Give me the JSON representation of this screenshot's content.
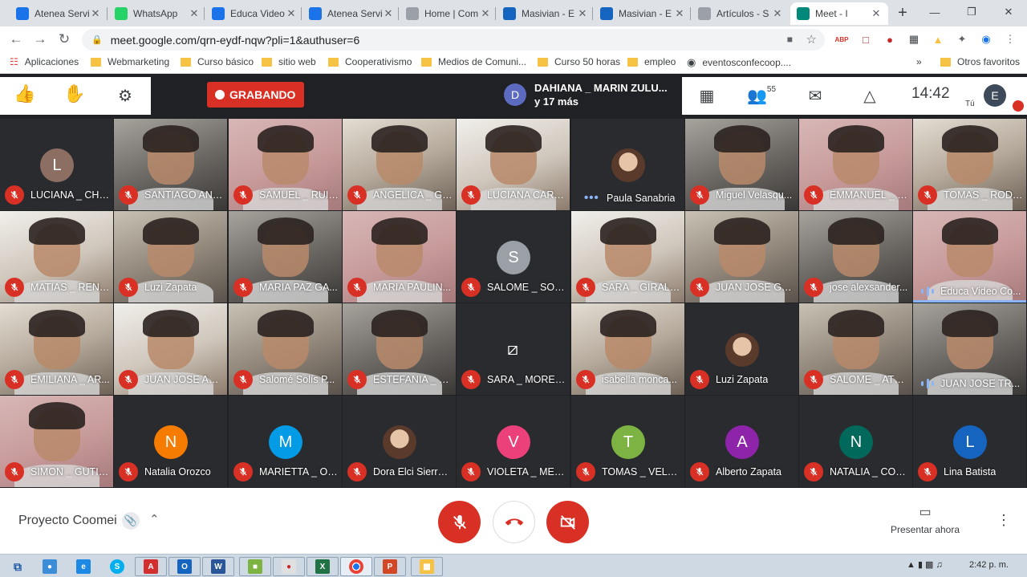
{
  "tabs": [
    {
      "title": "Atenea Servi",
      "icon": "atenea-icon",
      "color": "#1a73e8"
    },
    {
      "title": "WhatsApp",
      "icon": "whatsapp-icon",
      "color": "#25d366"
    },
    {
      "title": "Educa Video",
      "icon": "atenea-icon",
      "color": "#1a73e8"
    },
    {
      "title": "Atenea Servi",
      "icon": "atenea-icon",
      "color": "#1a73e8"
    },
    {
      "title": "Home | Com",
      "icon": "wordpress-icon",
      "color": "#9aa0a6"
    },
    {
      "title": "Masivian - E",
      "icon": "masivian-icon",
      "color": "#1565c0"
    },
    {
      "title": "Masivian - E",
      "icon": "masivian-icon",
      "color": "#1565c0"
    },
    {
      "title": "Artículos - S",
      "icon": "wordpress-icon",
      "color": "#9aa0a6"
    },
    {
      "title": "Meet - I",
      "icon": "meet-icon",
      "color": "#00897b"
    }
  ],
  "toolbar": {
    "url": "meet.google.com/qrn-eydf-nqw?pli=1&authuser=6"
  },
  "bookmarks": [
    "Aplicaciones",
    "Webmarketing",
    "Curso básico",
    "sitio web",
    "Cooperativismo",
    "Medios de Comuni...",
    "Curso 50 horas",
    "empleo",
    "eventosconfecoop....",
    "Otros favoritos"
  ],
  "meet": {
    "recording_label": "GRABANDO",
    "speaker_initial": "D",
    "speaker_name": "DAHIANA _ MARIN ZULU...",
    "speaker_more": "y 17 más",
    "participants_count": "55",
    "time": "14:42",
    "self_label": "Tú",
    "self_initial": "E"
  },
  "participants": [
    {
      "name": "LUCIANA _ CHA...",
      "kind": "letter",
      "initial": "L",
      "color": "#8d6e63"
    },
    {
      "name": "SANTIAGO AND...",
      "kind": "video"
    },
    {
      "name": "SAMUEL _ RUIZ...",
      "kind": "video"
    },
    {
      "name": "ANGELICA _ GU...",
      "kind": "video"
    },
    {
      "name": "LUCIANA CARO...",
      "kind": "video"
    },
    {
      "name": "Paula Sanabria",
      "kind": "photo"
    },
    {
      "name": "Miguel Velasqu...",
      "kind": "video"
    },
    {
      "name": "EMMANUEL _ C...",
      "kind": "video"
    },
    {
      "name": "TOMAS _ RODR...",
      "kind": "video"
    },
    {
      "name": "MATIAS _ REND...",
      "kind": "video"
    },
    {
      "name": "Luzi Zapata",
      "kind": "video"
    },
    {
      "name": "MARIA PAZ GA...",
      "kind": "video"
    },
    {
      "name": "MARIA PAULIN...",
      "kind": "video"
    },
    {
      "name": "SALOME _ SOLI...",
      "kind": "letter",
      "initial": "S",
      "color": "#9aa0a6"
    },
    {
      "name": "SARA _ GIRALD...",
      "kind": "video"
    },
    {
      "name": "JUAN JOSE GA...",
      "kind": "video"
    },
    {
      "name": "jose alexsander...",
      "kind": "video"
    },
    {
      "name": "Educa Video Co...",
      "kind": "video"
    },
    {
      "name": "EMILIANA _ AR...",
      "kind": "video"
    },
    {
      "name": "JUAN JOSE AG...",
      "kind": "video"
    },
    {
      "name": "Salomé Solís P...",
      "kind": "video"
    },
    {
      "name": "ESTEFANIA _ M...",
      "kind": "video"
    },
    {
      "name": "SARA _ MOREN...",
      "kind": "camoff"
    },
    {
      "name": "isabella monca...",
      "kind": "video"
    },
    {
      "name": "Luzi Zapata",
      "kind": "photo"
    },
    {
      "name": "SALOME _ ATE...",
      "kind": "video"
    },
    {
      "name": "JUAN JOSE TR...",
      "kind": "video"
    },
    {
      "name": "SIMON _ GUTIE...",
      "kind": "video"
    },
    {
      "name": "Natalia Orozco",
      "kind": "letter",
      "initial": "N",
      "color": "#f57c00"
    },
    {
      "name": "MARIETTA _ OR...",
      "kind": "letter",
      "initial": "M",
      "color": "#039be5"
    },
    {
      "name": "Dora Elci Sierra ...",
      "kind": "photo"
    },
    {
      "name": "VIOLETA _ MED...",
      "kind": "letter",
      "initial": "V",
      "color": "#ec407a"
    },
    {
      "name": "TOMAS _ VELA...",
      "kind": "letter",
      "initial": "T",
      "color": "#7cb342"
    },
    {
      "name": "Alberto Zapata",
      "kind": "letter",
      "initial": "A",
      "color": "#8e24aa"
    },
    {
      "name": "NATALIA _ COR...",
      "kind": "letter",
      "initial": "N",
      "color": "#00695c"
    },
    {
      "name": "Lina Batista",
      "kind": "letter",
      "initial": "L",
      "color": "#1565c0"
    }
  ],
  "bottom": {
    "meeting_name": "Proyecto Coomei",
    "present_label": "Presentar ahora"
  },
  "taskbar": {
    "time": "2:42 p. m."
  }
}
